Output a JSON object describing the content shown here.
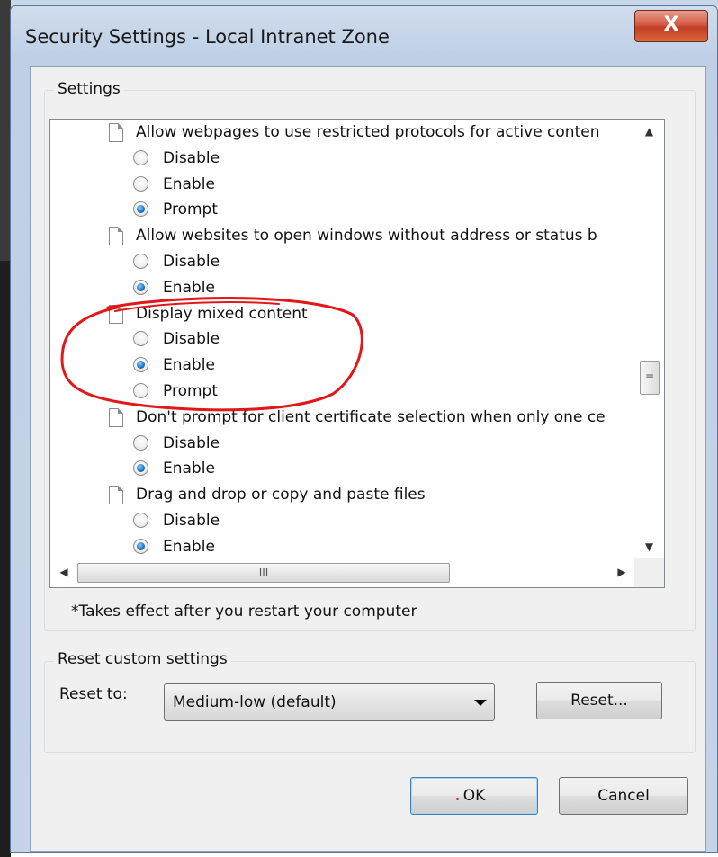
{
  "window": {
    "title": "Security Settings - Local Intranet Zone",
    "close_label": "X"
  },
  "settings_group": {
    "label": "Settings",
    "items": [
      {
        "type": "header",
        "label": "Allow webpages to use restricted protocols for active conten"
      },
      {
        "type": "option",
        "label": "Disable",
        "checked": false
      },
      {
        "type": "option",
        "label": "Enable",
        "checked": false
      },
      {
        "type": "option",
        "label": "Prompt",
        "checked": true
      },
      {
        "type": "header",
        "label": "Allow websites to open windows without address or status b"
      },
      {
        "type": "option",
        "label": "Disable",
        "checked": false
      },
      {
        "type": "option",
        "label": "Enable",
        "checked": true
      },
      {
        "type": "header",
        "label": "Display mixed content"
      },
      {
        "type": "option",
        "label": "Disable",
        "checked": false
      },
      {
        "type": "option",
        "label": "Enable",
        "checked": true
      },
      {
        "type": "option",
        "label": "Prompt",
        "checked": false
      },
      {
        "type": "header",
        "label": "Don't prompt for client certificate selection when only one ce"
      },
      {
        "type": "option",
        "label": "Disable",
        "checked": false
      },
      {
        "type": "option",
        "label": "Enable",
        "checked": true
      },
      {
        "type": "header",
        "label": "Drag and drop or copy and paste files"
      },
      {
        "type": "option",
        "label": "Disable",
        "checked": false
      },
      {
        "type": "option",
        "label": "Enable",
        "checked": true
      }
    ],
    "note": "*Takes effect after you restart your computer"
  },
  "reset_group": {
    "label": "Reset custom settings",
    "reset_to_label": "Reset to:",
    "selected_level": "Medium-low (default)",
    "reset_button": "Reset..."
  },
  "footer": {
    "ok_label": "OK",
    "cancel_label": "Cancel"
  },
  "scrollbar_glyphs": {
    "up": "▲",
    "down": "▼",
    "left": "◀",
    "right": "▶",
    "v_grip": "≡",
    "h_grip": "III"
  },
  "colors": {
    "annotation_red": "#e01818",
    "radio_checked": "#1f6fc2",
    "close_button": "#c9452d"
  }
}
